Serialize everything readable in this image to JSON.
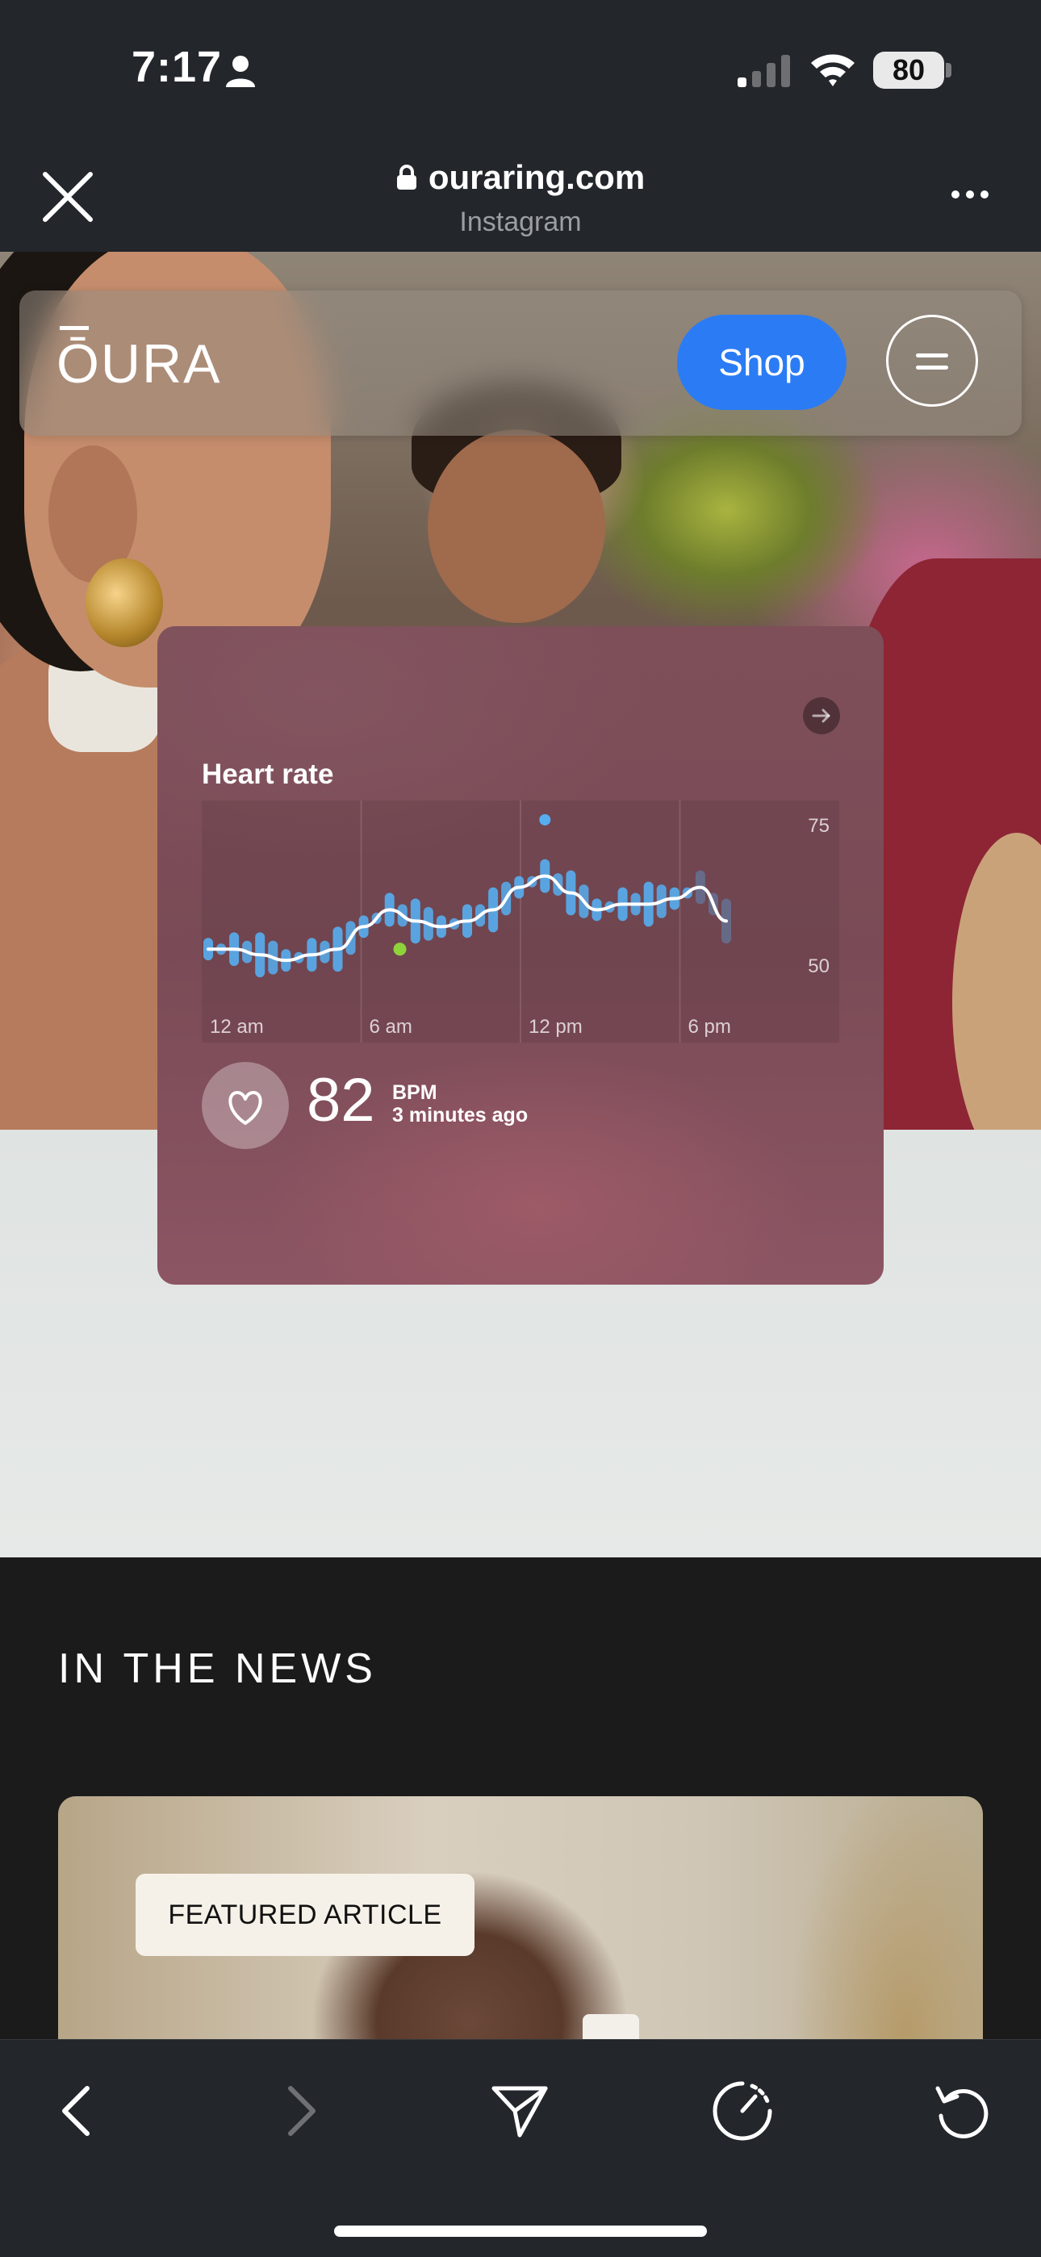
{
  "status_bar": {
    "time": "7:17",
    "battery": "80"
  },
  "browser": {
    "url": "ouraring.com",
    "source": "Instagram"
  },
  "nav": {
    "logo": "ŌURA",
    "shop_label": "Shop"
  },
  "heart_card": {
    "title": "Heart rate",
    "value": "82",
    "unit": "BPM",
    "updated": "3 minutes ago"
  },
  "chart_data": {
    "type": "line",
    "title": "Heart rate",
    "x_tick_labels": [
      "12 am",
      "6 am",
      "12 pm",
      "6 pm"
    ],
    "y_tick_labels": [
      "75",
      "50"
    ],
    "ylim": [
      45,
      78
    ],
    "x": [
      0,
      1,
      2,
      3,
      4,
      5,
      6,
      7,
      8,
      9,
      10,
      11,
      12,
      13,
      14,
      15,
      16,
      17,
      18,
      19,
      20
    ],
    "series": [
      {
        "values": [
          53,
          53,
          52,
          51,
          52,
          53,
          57,
          60,
          58,
          57,
          58,
          60,
          64,
          66,
          63,
          60,
          61,
          61,
          62,
          64,
          58
        ]
      }
    ],
    "grid": true,
    "colors": {
      "bars": "#56aef0",
      "line": "#ffffff",
      "highlight": "#8fd33a"
    }
  },
  "news": {
    "heading": "IN THE NEWS",
    "badge": "FEATURED ARTICLE"
  }
}
